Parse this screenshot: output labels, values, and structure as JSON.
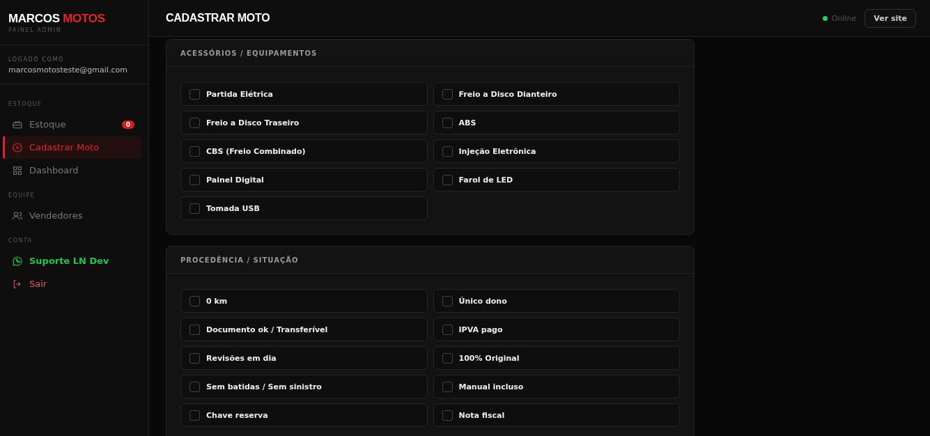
{
  "brand": {
    "name_first": "MARCOS",
    "name_second": "MOTOS",
    "subtitle": "PAINEL ADMIN"
  },
  "user": {
    "label": "LOGADO COMO",
    "email": "marcosmotosteste@gmail.com"
  },
  "nav_groups": [
    {
      "title": "ESTOQUE",
      "items": [
        {
          "label": "Estoque",
          "kind": "stock",
          "badge": "0",
          "selected": false
        },
        {
          "label": "Cadastrar Moto",
          "kind": "register",
          "selected": true
        },
        {
          "label": "Dashboard",
          "kind": "dashboard",
          "selected": false
        }
      ]
    },
    {
      "title": "EQUIPE",
      "items": [
        {
          "label": "Vendedores",
          "kind": "team",
          "selected": false
        }
      ]
    },
    {
      "title": "CONTA",
      "items": [
        {
          "label": "Suporte LN Dev",
          "kind": "support",
          "selected": false
        },
        {
          "label": "Sair",
          "kind": "logout",
          "selected": false
        }
      ]
    }
  ],
  "header": {
    "title": "CADASTRAR MOTO",
    "status": "Online",
    "online": true,
    "button": "Ver site"
  },
  "sections": [
    {
      "title": "ACESSÓRIOS / EQUIPAMENTOS",
      "options": [
        {
          "label": "Partida Elétrica",
          "checked": false
        },
        {
          "label": "Freio a Disco Dianteiro",
          "checked": false
        },
        {
          "label": "Freio a Disco Traseiro",
          "checked": false
        },
        {
          "label": "ABS",
          "checked": false
        },
        {
          "label": "CBS (Freio Combinado)",
          "checked": false
        },
        {
          "label": "Injeção Eletrônica",
          "checked": false
        },
        {
          "label": "Painel Digital",
          "checked": false
        },
        {
          "label": "Farol de LED",
          "checked": false
        },
        {
          "label": "Tomada USB",
          "checked": false
        }
      ]
    },
    {
      "title": "PROCEDÊNCIA / SITUAÇÃO",
      "options": [
        {
          "label": "0 km",
          "checked": false
        },
        {
          "label": "Único dono",
          "checked": false
        },
        {
          "label": "Documento ok / Transferível",
          "checked": false
        },
        {
          "label": "IPVA pago",
          "checked": false
        },
        {
          "label": "Revisões em dia",
          "checked": false
        },
        {
          "label": "100% Original",
          "checked": false
        },
        {
          "label": "Sem batidas / Sem sinistro",
          "checked": false
        },
        {
          "label": "Manual incluso",
          "checked": false
        },
        {
          "label": "Chave reserva",
          "checked": false
        },
        {
          "label": "Nota fiscal",
          "checked": false
        }
      ]
    }
  ]
}
